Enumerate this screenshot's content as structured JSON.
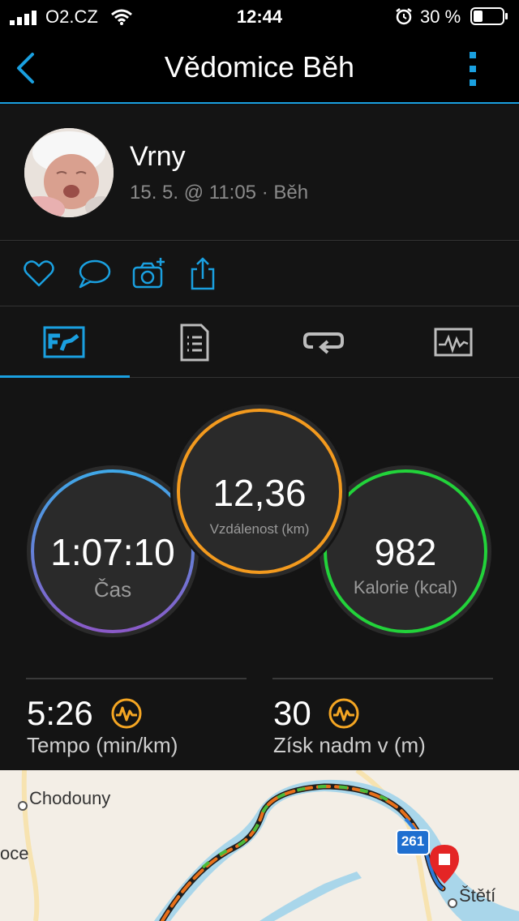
{
  "status_bar": {
    "carrier": "O2.CZ",
    "time": "12:44",
    "battery_pct": "30 %"
  },
  "nav": {
    "title": "Vědomice Běh"
  },
  "profile": {
    "name": "Vrny",
    "meta": "15. 5. @ 11:05 · Běh"
  },
  "stats": {
    "time": {
      "value": "1:07:10",
      "label": "Čas"
    },
    "distance": {
      "value": "12,36",
      "label": "Vzdálenost (km)"
    },
    "calories": {
      "value": "982",
      "label": "Kalorie (kcal)"
    },
    "pace": {
      "value": "5:26",
      "label": "Tempo (min/km)"
    },
    "elevation": {
      "value": "30",
      "label": "Získ nadm v (m)"
    }
  },
  "map": {
    "places": [
      "Chodouny",
      "oce",
      "Štětí"
    ],
    "road_badge": "261"
  },
  "colors": {
    "accent": "#1aa0e0",
    "distance_ring": "#f39a1e",
    "calories_ring": "#22d33a",
    "time_ring_start": "#3fa8e8",
    "time_ring_end": "#8a5ac8",
    "metric_icon": "#f5a623"
  },
  "icons": {
    "back": "chevron-left-icon",
    "more": "vertical-dots-icon",
    "like": "heart-icon",
    "comment": "speech-bubble-icon",
    "add_photo": "camera-plus-icon",
    "share": "share-icon",
    "tab_stats": "stats-chart-icon",
    "tab_details": "document-list-icon",
    "tab_laps": "laps-loop-icon",
    "tab_charts": "graph-line-icon"
  }
}
